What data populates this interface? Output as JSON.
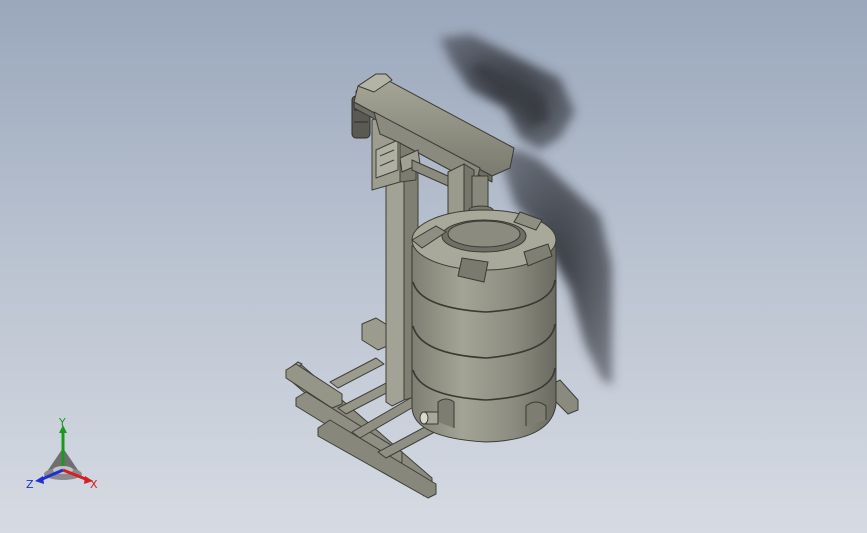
{
  "viewport": {
    "background_top": "#9aa7bc",
    "background_bottom": "#d6dbe3"
  },
  "model": {
    "body_color": "#8f8f82",
    "shadow_color": "#3c3f48"
  },
  "triad": {
    "x_label": "X",
    "y_label": "Y",
    "z_label": "Z",
    "x_color": "#d42020",
    "y_color": "#1a9a1a",
    "z_color": "#1f2fd0"
  }
}
